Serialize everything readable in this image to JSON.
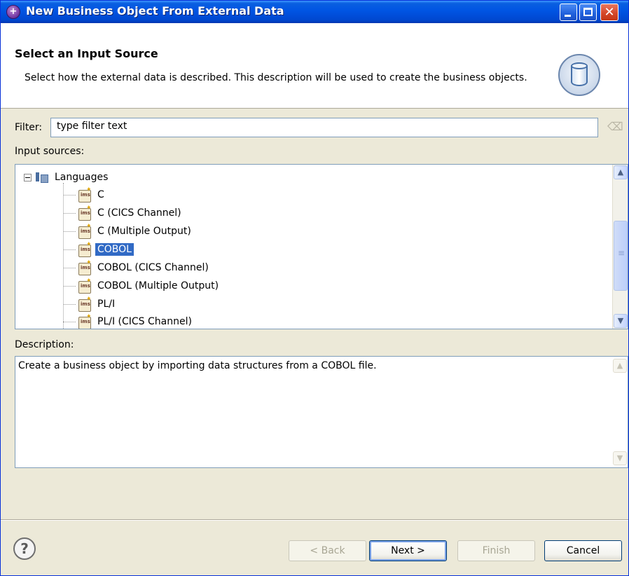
{
  "window": {
    "title": "New Business Object From External Data"
  },
  "header": {
    "title": "Select an Input Source",
    "description": "Select how the external data is described. This description will be used to create the business objects.",
    "image_icon": "database-cylinder-icon"
  },
  "filter": {
    "label": "Filter:",
    "value": "type filter text"
  },
  "sources": {
    "label": "Input sources:",
    "root": "Languages",
    "items": [
      {
        "label": "C"
      },
      {
        "label": "C (CICS Channel)"
      },
      {
        "label": "C (Multiple Output)"
      },
      {
        "label": "COBOL",
        "selected": true
      },
      {
        "label": "COBOL (CICS Channel)"
      },
      {
        "label": "COBOL (Multiple Output)"
      },
      {
        "label": "PL/I"
      },
      {
        "label": "PL/I (CICS Channel)"
      }
    ]
  },
  "description": {
    "label": "Description:",
    "text": "Create a business object by importing data structures from a COBOL file."
  },
  "buttons": {
    "back": "< Back",
    "next": "Next >",
    "finish": "Finish",
    "cancel": "Cancel"
  }
}
